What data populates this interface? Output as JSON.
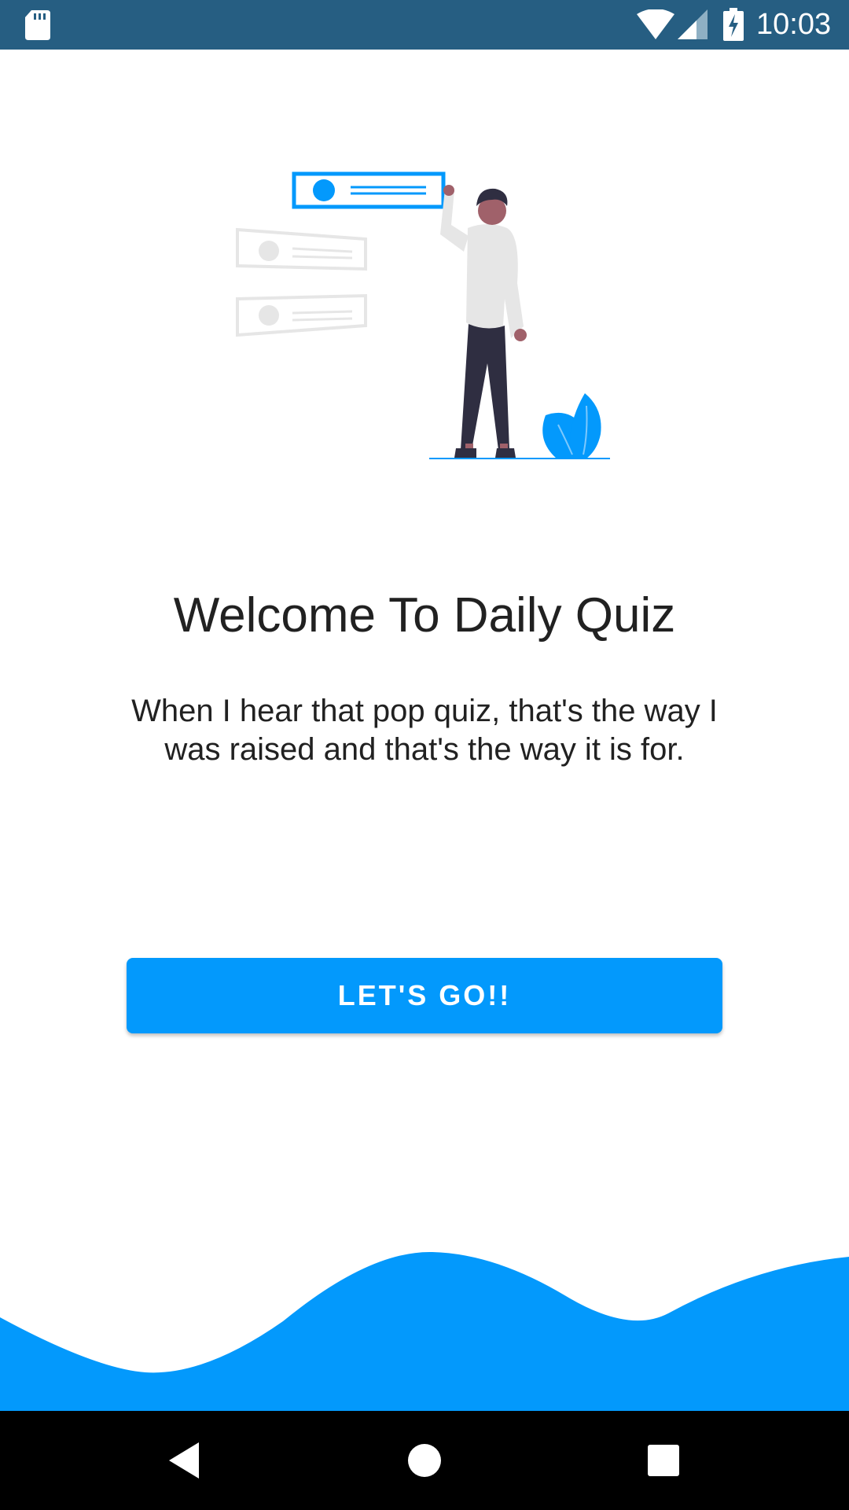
{
  "status_bar": {
    "time": "10:03",
    "icons": [
      "sd-card-icon",
      "wifi-icon",
      "signal-icon",
      "battery-charging-icon"
    ],
    "background": "#265e82"
  },
  "welcome": {
    "title": "Welcome To Daily Quiz",
    "subtitle": "When I hear that pop quiz, that's the way I was raised and that's the way it is for.",
    "button_label": "LET'S GO!!"
  },
  "colors": {
    "accent": "#0399fc",
    "text": "#212121",
    "nav_bar": "#000000"
  },
  "nav_bar": {
    "icons": [
      "back-icon",
      "home-icon",
      "recents-icon"
    ]
  }
}
